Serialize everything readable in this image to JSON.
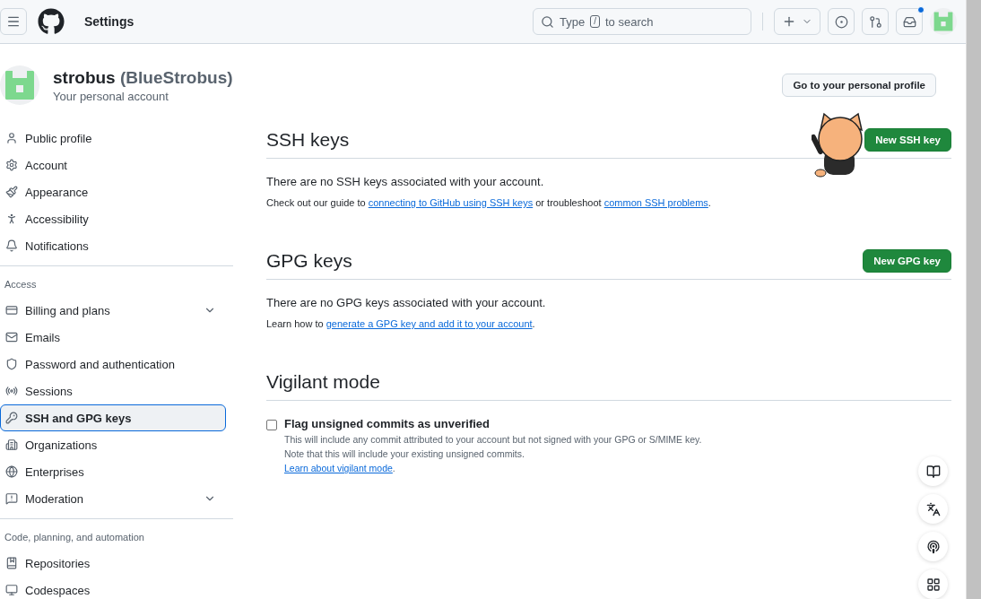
{
  "header": {
    "title": "Settings",
    "search": {
      "placeholder_before": "Type",
      "key": "/",
      "placeholder_after": "to search"
    },
    "inbox_unread": true
  },
  "profile": {
    "name": "strobus",
    "handle": "(BlueStrobus)",
    "subtitle": "Your personal account",
    "button": "Go to your personal profile"
  },
  "sidebar": {
    "sections": [
      {
        "items": [
          {
            "label": "Public profile",
            "selected": false,
            "expandable": false
          },
          {
            "label": "Account",
            "selected": false,
            "expandable": false
          },
          {
            "label": "Appearance",
            "selected": false,
            "expandable": false
          },
          {
            "label": "Accessibility",
            "selected": false,
            "expandable": false
          },
          {
            "label": "Notifications",
            "selected": false,
            "expandable": false
          }
        ]
      },
      {
        "heading": "Access",
        "items": [
          {
            "label": "Billing and plans",
            "selected": false,
            "expandable": true
          },
          {
            "label": "Emails",
            "selected": false,
            "expandable": false
          },
          {
            "label": "Password and authentication",
            "selected": false,
            "expandable": false
          },
          {
            "label": "Sessions",
            "selected": false,
            "expandable": false
          },
          {
            "label": "SSH and GPG keys",
            "selected": true,
            "expandable": false
          },
          {
            "label": "Organizations",
            "selected": false,
            "expandable": false
          },
          {
            "label": "Enterprises",
            "selected": false,
            "expandable": false
          },
          {
            "label": "Moderation",
            "selected": false,
            "expandable": true
          }
        ]
      },
      {
        "heading": "Code, planning, and automation",
        "items": [
          {
            "label": "Repositories",
            "selected": false,
            "expandable": false
          },
          {
            "label": "Codespaces",
            "selected": false,
            "expandable": false
          }
        ]
      }
    ]
  },
  "sections": [
    {
      "title": "SSH keys",
      "button": "New SSH key",
      "empty_text": "There are no SSH keys associated with your account.",
      "help": [
        {
          "text": "Check out our guide to "
        },
        {
          "link": "connecting to GitHub using SSH keys"
        },
        {
          "text": " or troubleshoot "
        },
        {
          "link": "common SSH problems"
        },
        {
          "text": "."
        }
      ]
    },
    {
      "title": "GPG keys",
      "button": "New GPG key",
      "empty_text": "There are no GPG keys associated with your account.",
      "help": [
        {
          "text": "Learn how to "
        },
        {
          "link": "generate a GPG key and add it to your account"
        },
        {
          "text": "."
        }
      ]
    }
  ],
  "vigilant": {
    "title": "Vigilant mode",
    "checkbox": {
      "label": "Flag unsigned commits as unverified",
      "checked": false
    },
    "notes": [
      "This will include any commit attributed to your account but not signed with your GPG or S/MIME key.",
      "Note that this will include your existing unsigned commits."
    ],
    "link": "Learn about vigilant mode",
    "link_suffix": "."
  }
}
